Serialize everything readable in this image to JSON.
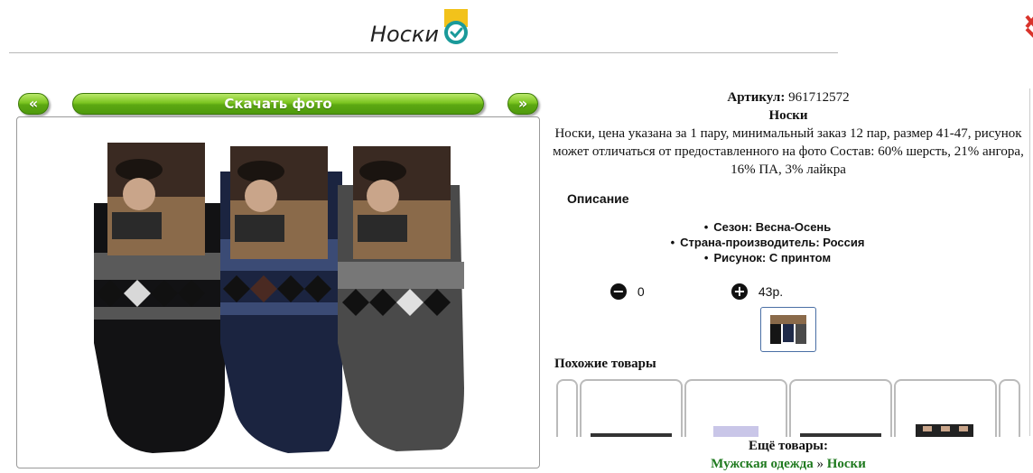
{
  "header": {
    "title": "Носки"
  },
  "gallery": {
    "prev_label": "«",
    "download_label": "Скачать фото",
    "next_label": "»"
  },
  "product": {
    "article_label": "Артикул:",
    "article_value": "961712572",
    "name": "Носки",
    "description": "Носки, цена указана за 1 пару, минимальный заказ 12 пар, размер 41-47, рисунок может отличаться от предоставленного на фото Состав: 60% шерсть, 21% ангора, 16% ПА, 3% лайкра"
  },
  "details": {
    "heading": "Описание",
    "attributes": [
      "Сезон: Весна-Осень",
      "Страна-производитель: Россия",
      "Рисунок: С принтом"
    ]
  },
  "quantity": {
    "minus_icon": "minus-circle-icon",
    "value": "0",
    "plus_icon": "plus-circle-icon",
    "price": "43р."
  },
  "similar": {
    "heading": "Похожие товары"
  },
  "more": {
    "label": "Ещё товары:",
    "breadcrumb_parent": "Мужская одежда",
    "separator": "»",
    "breadcrumb_current": "Носки"
  },
  "colors": {
    "accent_green": "#5ca812",
    "link_green": "#1f7a1f",
    "badge_yellow": "#f2c21b",
    "badge_teal": "#1a9a9a"
  }
}
